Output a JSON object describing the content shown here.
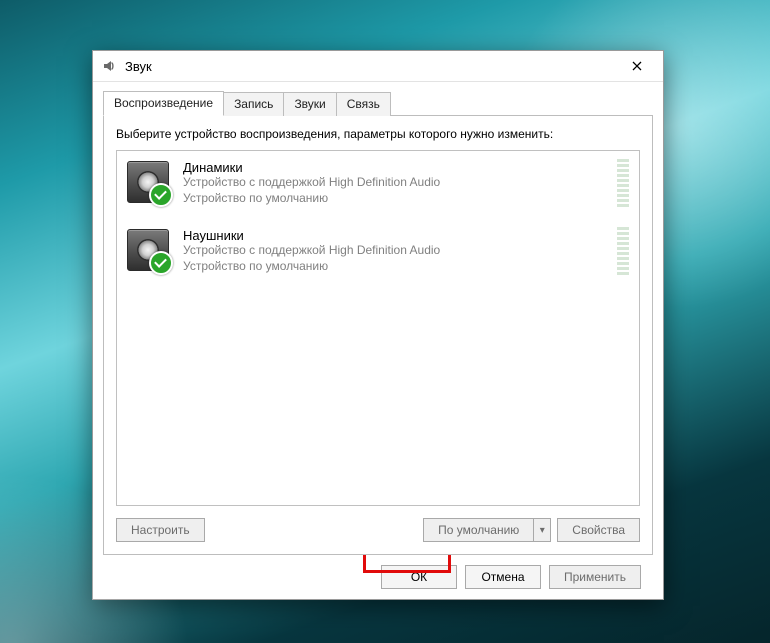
{
  "window": {
    "title": "Звук",
    "close_tooltip": "Закрыть"
  },
  "tabs": {
    "items": [
      {
        "label": "Воспроизведение",
        "active": true
      },
      {
        "label": "Запись",
        "active": false
      },
      {
        "label": "Звуки",
        "active": false
      },
      {
        "label": "Связь",
        "active": false
      }
    ]
  },
  "instruction": "Выберите устройство воспроизведения, параметры которого нужно изменить:",
  "devices": [
    {
      "title": "Динамики",
      "line1": "Устройство с поддержкой High Definition Audio",
      "line2": "Устройство по умолчанию",
      "default": true,
      "annotated": false
    },
    {
      "title": "Наушники",
      "line1": "Устройство с поддержкой High Definition Audio",
      "line2": "Устройство по умолчанию",
      "default": true,
      "annotated": true
    }
  ],
  "buttons": {
    "configure": "Настроить",
    "set_default": "По умолчанию",
    "properties": "Свойства",
    "ok": "ОК",
    "cancel": "Отмена",
    "apply": "Применить"
  },
  "annotations": {
    "highlight_device_index": 1,
    "highlight_button": "ok",
    "arrow_color": "#e10b0b"
  }
}
